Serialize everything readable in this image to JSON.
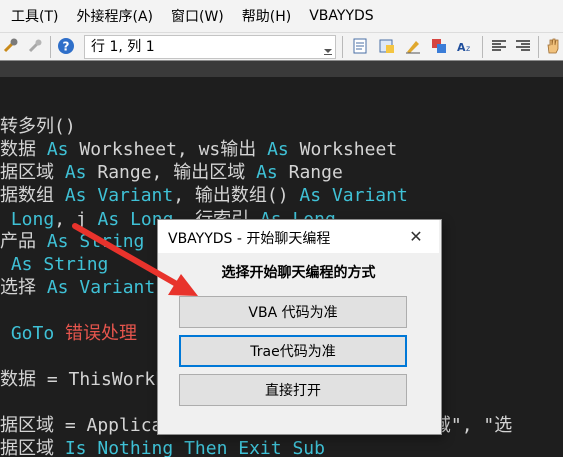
{
  "menu": [
    "工具(T)",
    "外接程序(A)",
    "窗口(W)",
    "帮助(H)",
    "VBAYYDS"
  ],
  "toolbar": {
    "location": "行 1, 列 1"
  },
  "code": {
    "lines": [
      [
        [
          "wh",
          "转多列()"
        ]
      ],
      [
        [
          "wh",
          "数据 "
        ],
        [
          "kw",
          "As"
        ],
        [
          "wh",
          " Worksheet, ws输出 "
        ],
        [
          "kw",
          "As"
        ],
        [
          "wh",
          " Worksheet"
        ]
      ],
      [
        [
          "wh",
          "据区域 "
        ],
        [
          "kw",
          "As"
        ],
        [
          "wh",
          " Range, 输出区域 "
        ],
        [
          "kw",
          "As"
        ],
        [
          "wh",
          " Range"
        ]
      ],
      [
        [
          "wh",
          "据数组 "
        ],
        [
          "kw",
          "As"
        ],
        [
          "kw",
          " Variant"
        ],
        [
          "wh",
          ", 输出数组() "
        ],
        [
          "kw",
          "As"
        ],
        [
          "kw",
          " Variant"
        ]
      ],
      [
        [
          "kw",
          " Long"
        ],
        [
          "wh",
          ", j "
        ],
        [
          "kw",
          "As"
        ],
        [
          "kw",
          " Long"
        ],
        [
          "wh",
          ", 行索引 "
        ],
        [
          "kw",
          "As"
        ],
        [
          "kw",
          " Long"
        ]
      ],
      [
        [
          "wh",
          "产品 "
        ],
        [
          "kw",
          "As"
        ],
        [
          "kw",
          " String"
        ]
      ],
      [
        [
          "kw",
          " As"
        ],
        [
          "kw",
          " String"
        ]
      ],
      [
        [
          "wh",
          "选择 "
        ],
        [
          "kw",
          "As"
        ],
        [
          "kw",
          " Variant"
        ]
      ],
      [
        [
          "wh",
          ""
        ]
      ],
      [
        [
          "kw",
          " GoTo"
        ],
        [
          "red",
          " 错误处理"
        ]
      ],
      [
        [
          "wh",
          ""
        ]
      ],
      [
        [
          "wh",
          "数据 = ThisWorkbook"
        ]
      ],
      [
        [
          "wh",
          ""
        ]
      ],
      [
        [
          "wh",
          "据区域 = Application.InputBox(\"请选择数据区域\", \"选"
        ]
      ],
      [
        [
          "wh",
          "据区域 "
        ],
        [
          "kw",
          "Is"
        ],
        [
          "kw",
          " Nothing"
        ],
        [
          "kw",
          " Then"
        ],
        [
          "kw",
          " Exit"
        ],
        [
          "kw",
          " Sub"
        ]
      ]
    ]
  },
  "dialog": {
    "title": "VBAYYDS - 开始聊天编程",
    "close": "✕",
    "prompt": "选择开始聊天编程的方式",
    "buttons": [
      "VBA 代码为准",
      "Trae代码为准",
      "直接打开"
    ]
  },
  "colors": {
    "code_bg": "#1e1e1e",
    "keyword": "#3fc1d6",
    "arrow": "#e8332c",
    "focus": "#0078d7"
  }
}
